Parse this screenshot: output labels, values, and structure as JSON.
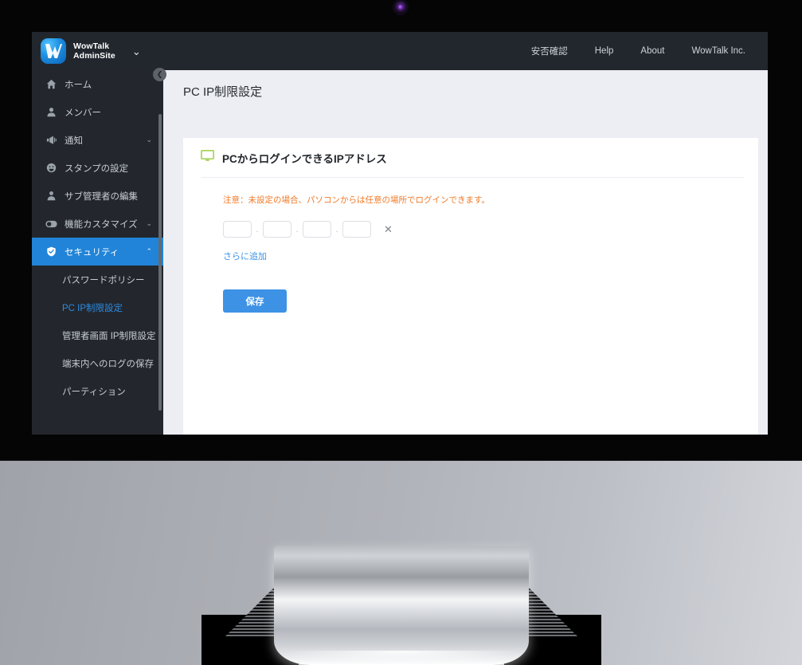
{
  "brand": {
    "name": "WowTalk\nAdminSite",
    "caret_icon": "chevron-down-icon"
  },
  "topnav": {
    "items": [
      {
        "label": "安否確認"
      },
      {
        "label": "Help"
      },
      {
        "label": "About"
      },
      {
        "label": "WowTalk Inc."
      }
    ]
  },
  "sidebar": {
    "collapse_icon": "chevron-left-icon",
    "items": [
      {
        "label": "ホーム",
        "icon": "home-icon",
        "chevron": "",
        "active": false
      },
      {
        "label": "メンバー",
        "icon": "user-icon",
        "chevron": "",
        "active": false
      },
      {
        "label": "通知",
        "icon": "megaphone-icon",
        "chevron": "⌄",
        "active": false
      },
      {
        "label": "スタンプの設定",
        "icon": "smiley-icon",
        "chevron": "",
        "active": false
      },
      {
        "label": "サブ管理者の編集",
        "icon": "user-tie-icon",
        "chevron": "",
        "active": false
      },
      {
        "label": "機能カスタマイズ",
        "icon": "toggle-icon",
        "chevron": "⌄",
        "active": false
      },
      {
        "label": "セキュリティ",
        "icon": "shield-icon",
        "chevron": "⌃",
        "active": true
      }
    ],
    "subitems": [
      {
        "label": "パスワードポリシー",
        "selected": false
      },
      {
        "label": "PC IP制限設定",
        "selected": true
      },
      {
        "label": "管理者画面 IP制限設定",
        "selected": false
      },
      {
        "label": "端末内へのログの保存",
        "selected": false
      },
      {
        "label": "パーティション",
        "selected": false
      }
    ]
  },
  "page": {
    "title": "PC IP制限設定"
  },
  "card": {
    "icon": "monitor-icon",
    "heading": "PCからログインできるIPアドレス",
    "warning": "注意：未設定の場合、パソコンからは任意の場所でログインできます。",
    "ip_row": {
      "octets": [
        "",
        "",
        "",
        ""
      ],
      "separator": ".",
      "remove_label": "✕",
      "remove_icon": "close-icon"
    },
    "add_link": "さらに追加",
    "save_label": "保存"
  },
  "colors": {
    "accent_blue": "#3d92e5",
    "sidebar_active": "#2184d8",
    "warning_orange": "#f07a28",
    "topbar_dark": "#22272e",
    "monitor_icon_green": "#a8d45c"
  }
}
